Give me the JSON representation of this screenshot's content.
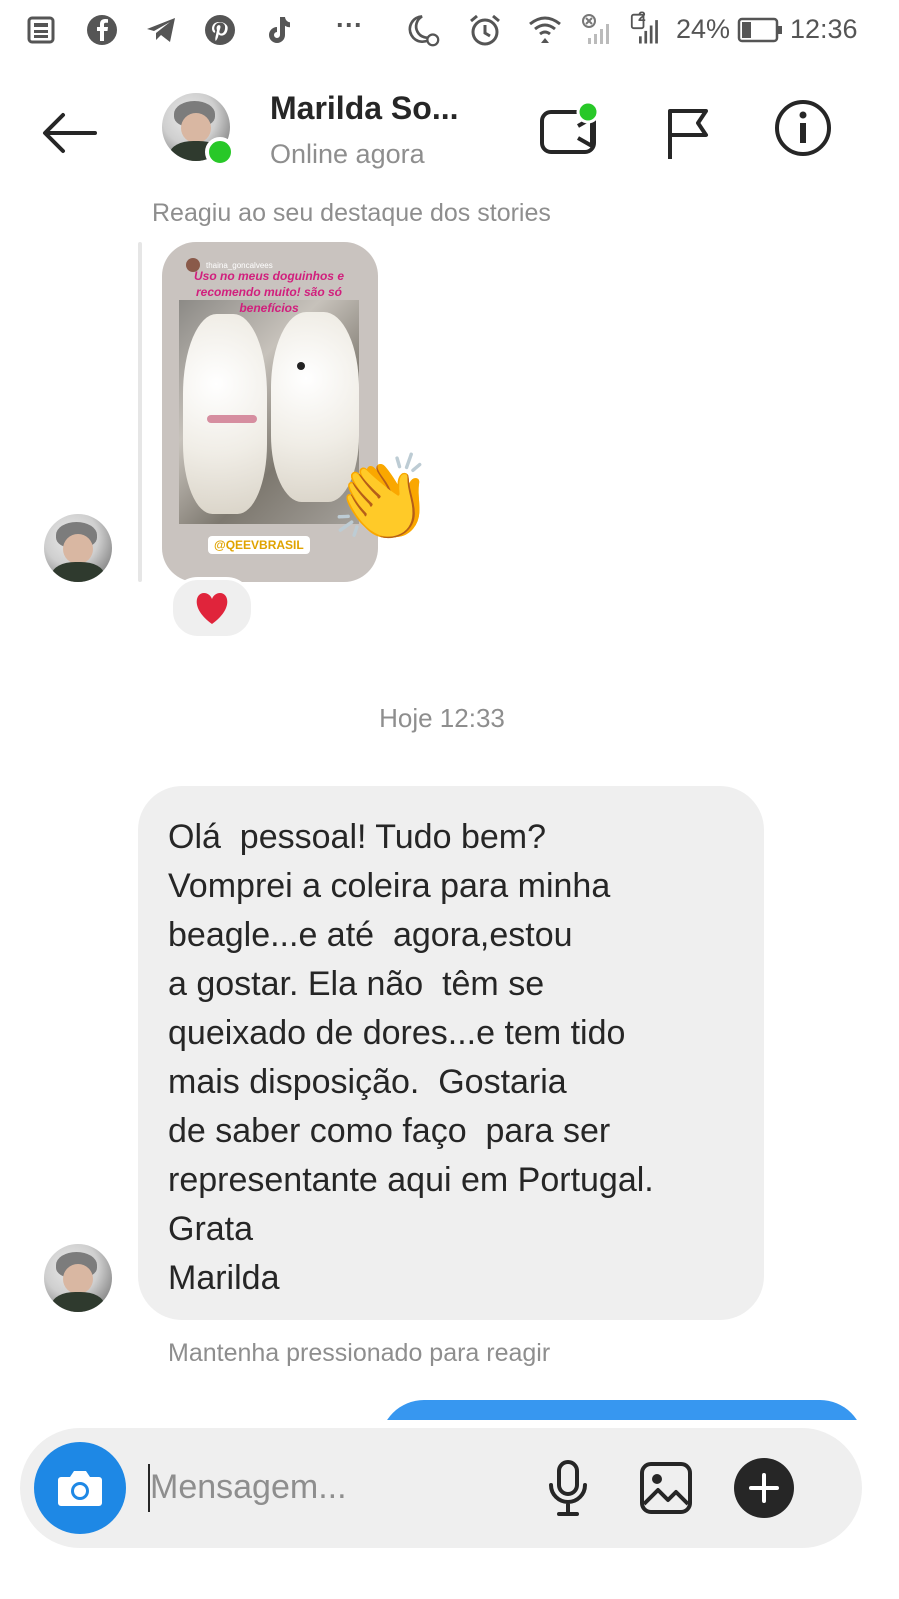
{
  "status_bar": {
    "left_icons": [
      "news-icon",
      "facebook-icon",
      "telegram-icon",
      "pinterest-icon",
      "tiktok-icon",
      "more-dots-icon"
    ],
    "more": "···",
    "battery": "24%",
    "time": "12:36",
    "sim_badge": "2"
  },
  "header": {
    "contact_name": "Marilda So...",
    "contact_status": "Online agora"
  },
  "story_reply": {
    "label": "Reagiu ao seu destaque dos stories",
    "story_user": "thaina_goncalvees",
    "story_caption": "Uso no meus doguinhos e recomendo muito! são só benefícios",
    "story_tag": "@QEEVBRASIL",
    "reaction_emoji": "👏",
    "heart_reaction": "❤"
  },
  "timestamp": "Hoje 12:33",
  "message": {
    "lines": [
      "Olá  pessoal! Tudo bem?",
      "Vomprei a coleira para minha",
      "beagle...e até  agora,estou",
      "a gostar. Ela não  têm se",
      "queixado de dores...e tem tido",
      "mais disposição.  Gostaria",
      "de saber como faço  para ser",
      "representante aqui em Portugal.",
      "Grata",
      "Marilda"
    ],
    "hint": "Mantenha pressionado para reagir"
  },
  "composer": {
    "placeholder": "Mensagem..."
  },
  "colors": {
    "accent": "#3797f0",
    "camera": "#1e88e5",
    "online": "#28c828",
    "bubble": "#efefef",
    "heart": "#e0243b"
  }
}
